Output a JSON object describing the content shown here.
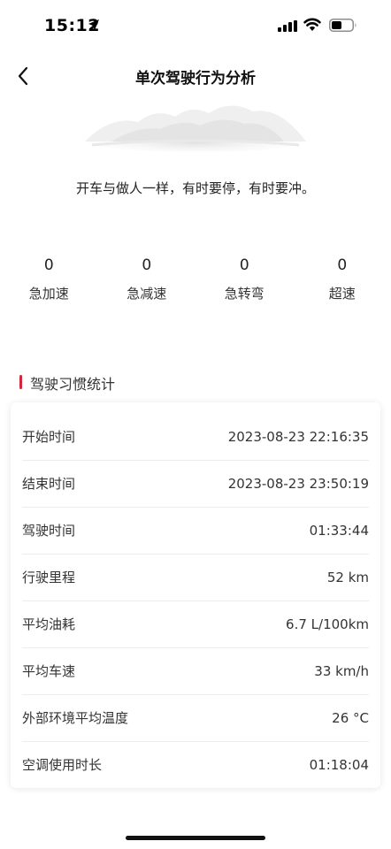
{
  "status_bar": {
    "time": "15:12"
  },
  "nav": {
    "title": "单次驾驶行为分析"
  },
  "slogan": "开车与做人一样，有时要停，有时要冲。",
  "stats": [
    {
      "value": "0",
      "label": "急加速"
    },
    {
      "value": "0",
      "label": "急减速"
    },
    {
      "value": "0",
      "label": "急转弯"
    },
    {
      "value": "0",
      "label": "超速"
    }
  ],
  "section": {
    "title": "驾驶习惯统计",
    "accent_color": "#d0283a"
  },
  "details": [
    {
      "label": "开始时间",
      "value": "2023-08-23 22:16:35"
    },
    {
      "label": "结束时间",
      "value": "2023-08-23 23:50:19"
    },
    {
      "label": "驾驶时间",
      "value": "01:33:44"
    },
    {
      "label": "行驶里程",
      "value": "52 km"
    },
    {
      "label": "平均油耗",
      "value": "6.7 L/100km"
    },
    {
      "label": "平均车速",
      "value": "33 km/h"
    },
    {
      "label": "外部环境平均温度",
      "value": "26 °C"
    },
    {
      "label": "空调使用时长",
      "value": "01:18:04"
    }
  ]
}
